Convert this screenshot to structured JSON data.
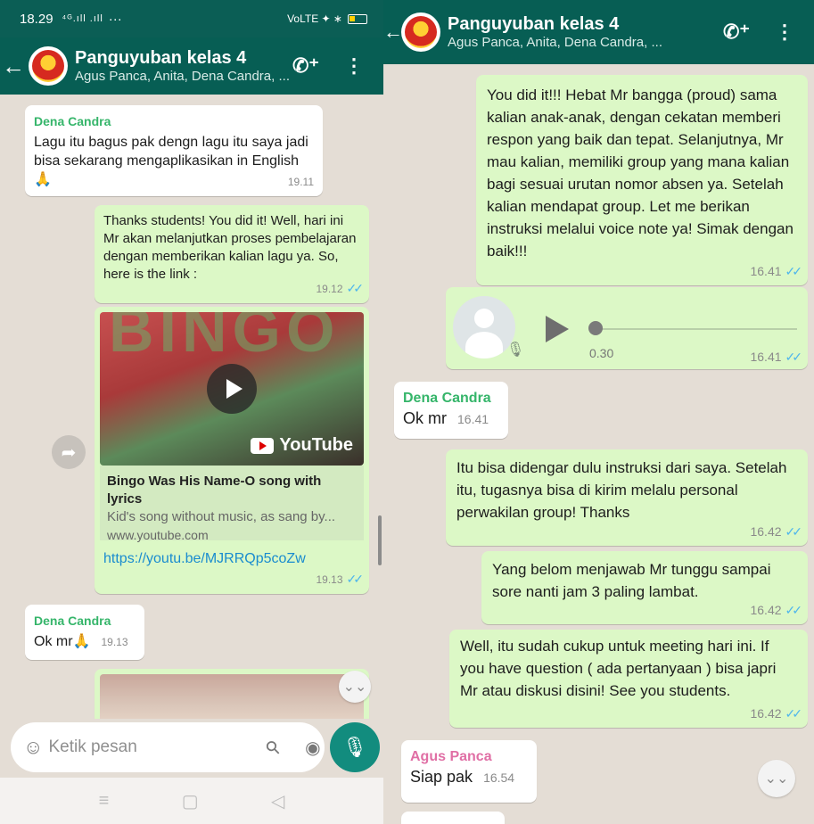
{
  "left": {
    "status_bar": {
      "time": "18.29",
      "signal": "⁴ᴳ.ıll .ıll",
      "extra": "···",
      "right": "VoLTE ✦ ∗"
    },
    "header": {
      "back": "←",
      "title": "Panguyuban kelas 4",
      "subtitle": "Agus Panca, Anita, Dena Candra, ..."
    },
    "messages": [
      {
        "sender": "Dena Candra",
        "text": "Lagu itu bagus pak dengn lagu itu saya jadi bisa sekarang mengaplikasikan in English",
        "emoji": "🙏",
        "time": "19.11"
      },
      {
        "text": "Thanks students! You did it! Well, hari ini Mr akan melanjutkan proses pembelajaran dengan memberikan kalian lagu ya. So, here is the link :",
        "time": "19.12"
      },
      {
        "yt_title": "Bingo Was His Name-O song with lyrics",
        "yt_desc": "Kid's song without music, as sang by...",
        "yt_domain": "www.youtube.com",
        "yt_brand": "YouTube",
        "thumb_text": "BINGO",
        "link": "https://youtu.be/MJRRQp5coZw",
        "time": "19.13"
      },
      {
        "sender": "Dena Candra",
        "text": "Ok mr",
        "emoji": "🙏",
        "time": "19.13"
      }
    ],
    "input": {
      "placeholder": "Ketik pesan"
    }
  },
  "right": {
    "header": {
      "back": "←",
      "title": "Panguyuban kelas 4",
      "subtitle": "Agus Panca, Anita, Dena Candra, ..."
    },
    "messages": [
      {
        "text": "You did it!!! Hebat Mr bangga (proud) sama kalian anak-anak, dengan cekatan memberi respon yang baik dan tepat. Selanjutnya, Mr mau kalian, memiliki group yang mana kalian bagi sesuai urutan nomor absen ya. Setelah kalian mendapat group. Let me berikan instruksi melalui voice note ya! Simak dengan baik!!!",
        "time": "16.41"
      },
      {
        "voice_duration": "0.30",
        "time": "16.41"
      },
      {
        "sender": "Dena Candra",
        "text": "Ok mr",
        "time": "16.41"
      },
      {
        "text": "Itu bisa didengar dulu instruksi dari saya. Setelah itu, tugasnya bisa di kirim melalu personal perwakilan group! Thanks",
        "time": "16.42"
      },
      {
        "text": "Yang belom menjawab Mr tunggu sampai sore nanti jam 3 paling lambat.",
        "time": "16.42"
      },
      {
        "text": "Well, itu sudah cukup untuk meeting hari ini. If you have question ( ada pertanyaan ) bisa japri Mr atau diskusi disini! See you students.",
        "time": "16.42"
      },
      {
        "sender": "Agus Panca",
        "text": "Siap pak",
        "time": "16.54"
      }
    ]
  },
  "colors": {
    "header": "#075e54",
    "outgoing": "#dcf8c6",
    "incoming": "#ffffff",
    "chat_bg": "#e4ddd5",
    "read_tick": "#4fb6ec"
  }
}
